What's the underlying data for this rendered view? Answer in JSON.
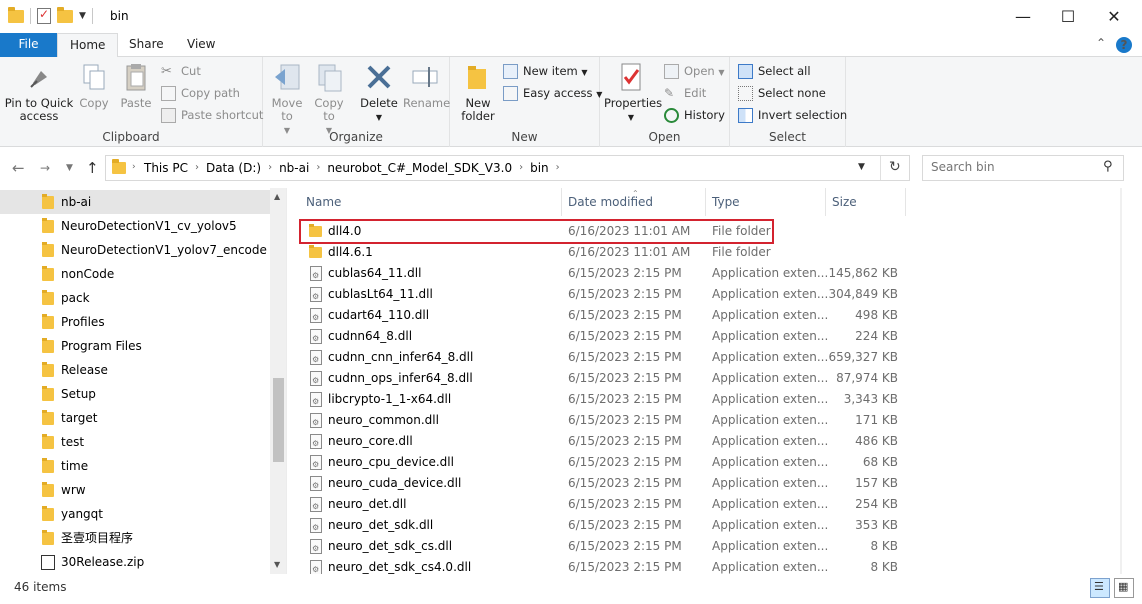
{
  "window": {
    "title": "bin",
    "minimize": "—",
    "maximize": "☐",
    "close": "✕"
  },
  "tabs": {
    "file": "File",
    "home": "Home",
    "share": "Share",
    "view": "View",
    "collapse": "⌃",
    "help": "?"
  },
  "ribbon": {
    "clipboard": {
      "label": "Clipboard",
      "pin": "Pin to Quick access",
      "copy": "Copy",
      "paste": "Paste",
      "cut": "Cut",
      "copy_path": "Copy path",
      "paste_shortcut": "Paste shortcut"
    },
    "organize": {
      "label": "Organize",
      "move_to": "Move to",
      "copy_to": "Copy to",
      "delete": "Delete",
      "rename": "Rename"
    },
    "new": {
      "label": "New",
      "new_folder": "New folder",
      "new_item": "New item",
      "easy_access": "Easy access"
    },
    "open": {
      "label": "Open",
      "properties": "Properties",
      "open": "Open",
      "edit": "Edit",
      "history": "History"
    },
    "select": {
      "label": "Select",
      "select_all": "Select all",
      "select_none": "Select none",
      "invert": "Invert selection"
    }
  },
  "address": {
    "crumbs": [
      "This PC",
      "Data (D:)",
      "nb-ai",
      "neurobot_C#_Model_SDK_V3.0",
      "bin"
    ],
    "search_placeholder": "Search bin"
  },
  "nav": {
    "items": [
      {
        "label": "nb-ai",
        "selected": true
      },
      {
        "label": "NeuroDetectionV1_cv_yolov5"
      },
      {
        "label": "NeuroDetectionV1_yolov7_encode"
      },
      {
        "label": "nonCode"
      },
      {
        "label": "pack"
      },
      {
        "label": "Profiles"
      },
      {
        "label": "Program Files"
      },
      {
        "label": "Release"
      },
      {
        "label": "Setup"
      },
      {
        "label": "target"
      },
      {
        "label": "test"
      },
      {
        "label": "time"
      },
      {
        "label": "wrw"
      },
      {
        "label": "yangqt"
      },
      {
        "label": "圣壹项目程序"
      },
      {
        "label": "30Release.zip"
      }
    ]
  },
  "columns": {
    "name": "Name",
    "date": "Date modified",
    "type": "Type",
    "size": "Size"
  },
  "files": [
    {
      "name": "dll4.0",
      "date": "6/16/2023 11:01 AM",
      "type": "File folder",
      "size": ""
    },
    {
      "name": "dll4.6.1",
      "date": "6/16/2023 11:01 AM",
      "type": "File folder",
      "size": ""
    },
    {
      "name": "cublas64_11.dll",
      "date": "6/15/2023 2:15 PM",
      "type": "Application exten...",
      "size": "145,862 KB"
    },
    {
      "name": "cublasLt64_11.dll",
      "date": "6/15/2023 2:15 PM",
      "type": "Application exten...",
      "size": "304,849 KB"
    },
    {
      "name": "cudart64_110.dll",
      "date": "6/15/2023 2:15 PM",
      "type": "Application exten...",
      "size": "498 KB"
    },
    {
      "name": "cudnn64_8.dll",
      "date": "6/15/2023 2:15 PM",
      "type": "Application exten...",
      "size": "224 KB"
    },
    {
      "name": "cudnn_cnn_infer64_8.dll",
      "date": "6/15/2023 2:15 PM",
      "type": "Application exten...",
      "size": "659,327 KB"
    },
    {
      "name": "cudnn_ops_infer64_8.dll",
      "date": "6/15/2023 2:15 PM",
      "type": "Application exten...",
      "size": "87,974 KB"
    },
    {
      "name": "libcrypto-1_1-x64.dll",
      "date": "6/15/2023 2:15 PM",
      "type": "Application exten...",
      "size": "3,343 KB"
    },
    {
      "name": "neuro_common.dll",
      "date": "6/15/2023 2:15 PM",
      "type": "Application exten...",
      "size": "171 KB"
    },
    {
      "name": "neuro_core.dll",
      "date": "6/15/2023 2:15 PM",
      "type": "Application exten...",
      "size": "486 KB"
    },
    {
      "name": "neuro_cpu_device.dll",
      "date": "6/15/2023 2:15 PM",
      "type": "Application exten...",
      "size": "68 KB"
    },
    {
      "name": "neuro_cuda_device.dll",
      "date": "6/15/2023 2:15 PM",
      "type": "Application exten...",
      "size": "157 KB"
    },
    {
      "name": "neuro_det.dll",
      "date": "6/15/2023 2:15 PM",
      "type": "Application exten...",
      "size": "254 KB"
    },
    {
      "name": "neuro_det_sdk.dll",
      "date": "6/15/2023 2:15 PM",
      "type": "Application exten...",
      "size": "353 KB"
    },
    {
      "name": "neuro_det_sdk_cs.dll",
      "date": "6/15/2023 2:15 PM",
      "type": "Application exten...",
      "size": "8 KB"
    },
    {
      "name": "neuro_det_sdk_cs4.0.dll",
      "date": "6/15/2023 2:15 PM",
      "type": "Application exten...",
      "size": "8 KB"
    }
  ],
  "status": {
    "count": "46 items"
  },
  "colors": {
    "accent": "#1979ca",
    "highlight": "#d3232f",
    "folder": "#f5c342"
  }
}
